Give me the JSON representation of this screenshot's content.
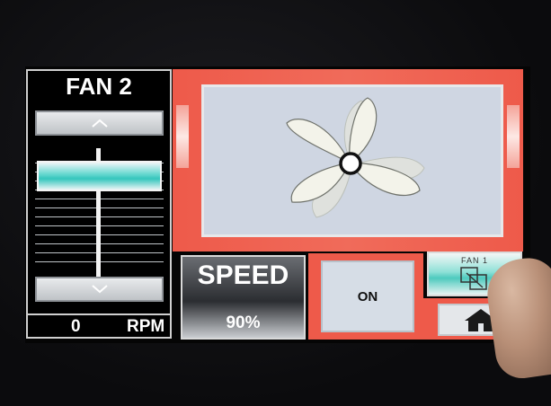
{
  "left_panel": {
    "title": "FAN 2",
    "rpm_value": "0",
    "rpm_unit": "RPM",
    "up_icon": "chevron-up-icon",
    "down_icon": "chevron-down-icon",
    "slider_level": 0.9
  },
  "speed": {
    "label": "SPEED",
    "value": "90%"
  },
  "power": {
    "label": "ON"
  },
  "nav": {
    "fan1_label": "FAN 1",
    "fan1_icon": "window-switch-icon",
    "home_icon": "home-icon"
  },
  "colors": {
    "accent_red": "#ee5a4a",
    "accent_teal": "#35c6bd",
    "window_bg": "#cfd6e2"
  }
}
